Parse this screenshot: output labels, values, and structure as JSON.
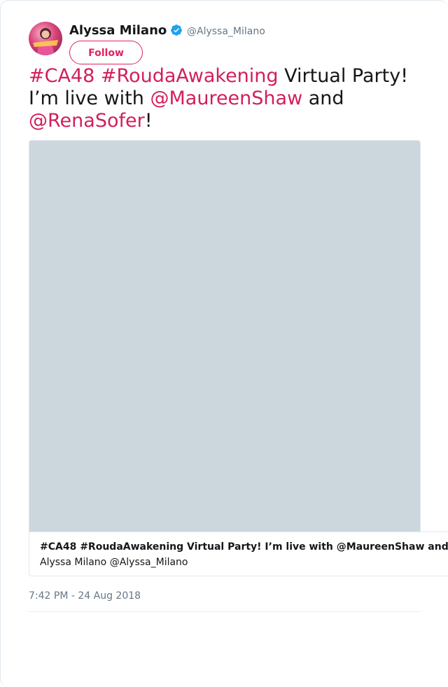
{
  "author": {
    "name": "Alyssa Milano",
    "handle": "@Alyssa_Milano",
    "verified": true,
    "avatar_icon": "profile-photo"
  },
  "follow_button": {
    "label": "Follow"
  },
  "tweet": {
    "hashtag_1": "#CA48",
    "hashtag_2": "#RoudaAwakening",
    "text_1": " Virtual Party! I’m live with ",
    "mention_1": "@MaureenShaw",
    "text_2": " and ",
    "mention_2": "@RenaSofer",
    "text_3": "!"
  },
  "quote_card": {
    "title": "#CA48 #RoudaAwakening Virtual Party! I’m live with @MaureenShaw and",
    "author": "Alyssa Milano @Alyssa_Milano"
  },
  "timestamp": "7:42 PM - 24 Aug 2018",
  "colors": {
    "link": "#d21f5a",
    "follow_accent": "#e0245e",
    "verified": "#1da1f2",
    "media_placeholder": "#ccd6dd",
    "secondary_text": "#657786"
  }
}
